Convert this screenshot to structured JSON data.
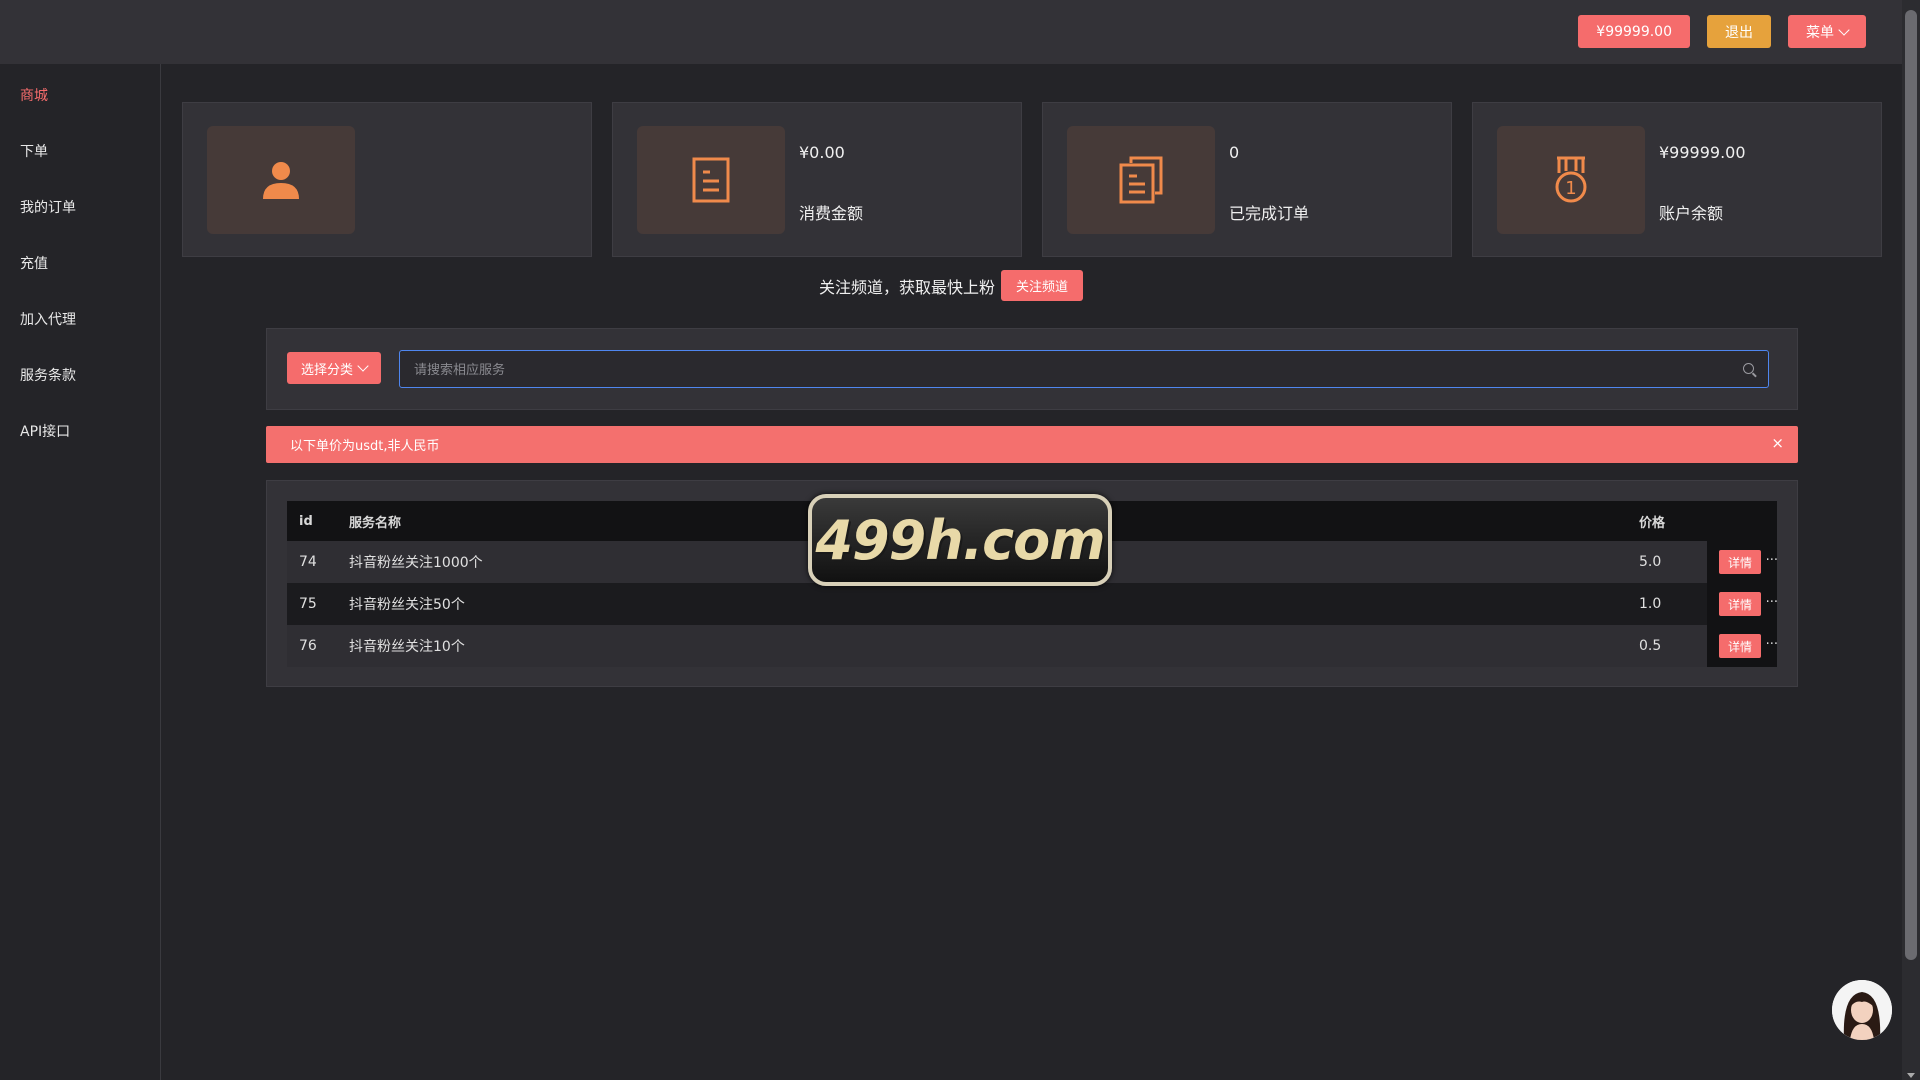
{
  "header": {
    "balance_label": "¥99999.00",
    "logout_label": "退出",
    "menu_label": "菜单"
  },
  "sidebar": {
    "items": [
      {
        "label": "商城"
      },
      {
        "label": "下单"
      },
      {
        "label": "我的订单"
      },
      {
        "label": "充值"
      },
      {
        "label": "加入代理"
      },
      {
        "label": "服务条款"
      },
      {
        "label": "API接口"
      }
    ]
  },
  "stats": [
    {
      "icon": "user-icon",
      "value": "",
      "label": ""
    },
    {
      "icon": "document-icon",
      "value": "¥0.00",
      "label": "消费金额"
    },
    {
      "icon": "copy-document-icon",
      "value": "0",
      "label": "已完成订单"
    },
    {
      "icon": "medal-icon",
      "value": "¥99999.00",
      "label": "账户余额"
    }
  ],
  "follow": {
    "text": "关注频道，获取最快上粉",
    "button_label": "关注频道"
  },
  "search": {
    "category_label": "选择分类",
    "placeholder": "请搜索相应服务"
  },
  "alert": {
    "text": "以下单价为usdt,非人民币",
    "close": "×"
  },
  "table": {
    "headers": {
      "id": "id",
      "name": "服务名称",
      "price": "价格"
    },
    "rows": [
      {
        "id": "74",
        "name": "抖音粉丝关注1000个",
        "price": "5.0",
        "action": "详情"
      },
      {
        "id": "75",
        "name": "抖音粉丝关注50个",
        "price": "1.0",
        "action": "详情"
      },
      {
        "id": "76",
        "name": "抖音粉丝关注10个",
        "price": "0.5",
        "action": "详情"
      }
    ],
    "overflow": "..."
  },
  "watermark": "499h.com",
  "colors": {
    "accent": "#f56c6c",
    "warning": "#e6a23c",
    "icon": "#f08a4b",
    "background": "#242428",
    "panel": "#333237"
  }
}
